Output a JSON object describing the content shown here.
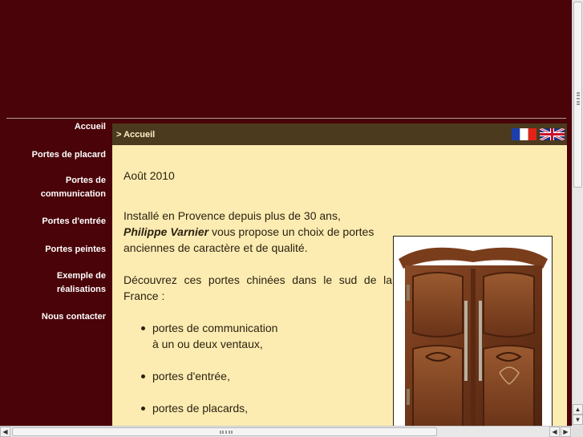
{
  "nav": {
    "items": [
      {
        "label": "Accueil"
      },
      {
        "label": "Portes de placard"
      },
      {
        "label_line1": "Portes de",
        "label_line2": "communication"
      },
      {
        "label": "Portes d'entrée"
      },
      {
        "label": "Portes peintes"
      },
      {
        "label_line1": "Exemple de",
        "label_line2": "réalisations"
      },
      {
        "label": "Nous contacter"
      }
    ]
  },
  "breadcrumb": {
    "text": "> Accueil"
  },
  "languages": {
    "fr": "french-flag-icon",
    "en": "uk-flag-icon"
  },
  "content": {
    "date": "Août 2010",
    "intro_line1": "Installé en Provence depuis plus de 30 ans,",
    "vendor_name": "Philippe Varnier",
    "intro_rest": " vous propose un choix de portes anciennes de caractère et de qualité.",
    "discover": "Découvrez ces portes chinées dans le sud de la France :",
    "list": [
      {
        "line1": "portes de communication",
        "line2": "à un ou deux ventaux,"
      },
      {
        "line1": "portes d'entrée,"
      },
      {
        "line1": "portes de placards,"
      }
    ]
  },
  "colors": {
    "page_background": "#4a0308",
    "content_background": "#fdecb2",
    "breadcrumb_bar": "#4b3a1e"
  }
}
